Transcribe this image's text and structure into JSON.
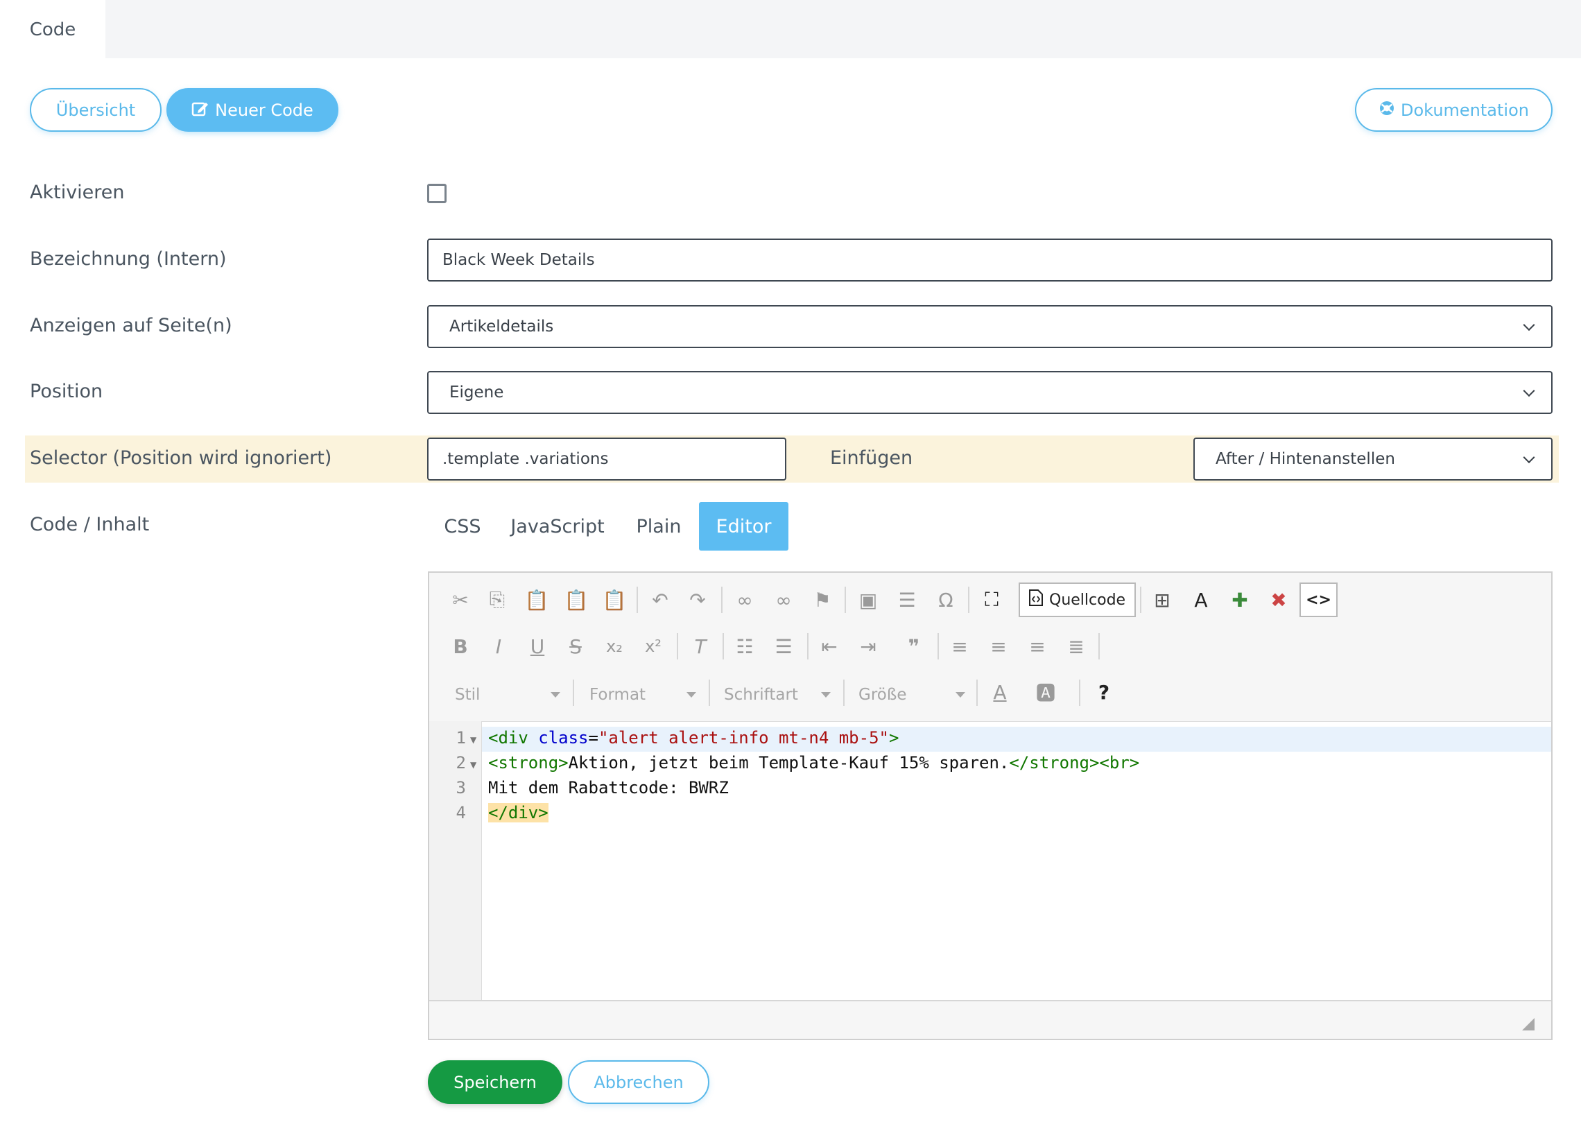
{
  "tabs": [
    {
      "label": "Code"
    }
  ],
  "header": {
    "overview_label": "Übersicht",
    "new_code_label": "Neuer Code",
    "docs_label": "Dokumentation"
  },
  "form": {
    "activate_label": "Aktivieren",
    "activate_checked": false,
    "name_label": "Bezeichnung (Intern)",
    "name_value": "Black Week Details",
    "pages_label": "Anzeigen auf Seite(n)",
    "pages_value": "Artikeldetails",
    "position_label": "Position",
    "position_value": "Eigene",
    "selector_label": "Selector (Position wird ignoriert)",
    "selector_value": ".template .variations",
    "insert_label": "Einfügen",
    "insert_value": "After / Hintenanstellen",
    "code_label": "Code / Inhalt"
  },
  "code_tabs": [
    {
      "label": "CSS",
      "active": false
    },
    {
      "label": "JavaScript",
      "active": false
    },
    {
      "label": "Plain",
      "active": false
    },
    {
      "label": "Editor",
      "active": true
    }
  ],
  "toolbar": {
    "source_label": "Quellcode",
    "style_label": "Stil",
    "format_label": "Format",
    "font_label": "Schriftart",
    "size_label": "Größe",
    "help_label": "?"
  },
  "code": {
    "line_numbers": [
      "1",
      "2",
      "3",
      "4"
    ],
    "lines": [
      "<div class=\"alert alert-info mt-n4 mb-5\">",
      "<strong>Aktion, jetzt beim Template-Kauf 15% sparen.</strong><br>",
      "Mit dem Rabattcode: BWRZ",
      "</div>"
    ]
  },
  "actions": {
    "save_label": "Speichern",
    "cancel_label": "Abbrechen"
  },
  "colors": {
    "accent": "#5cbcf2",
    "save_green": "#159a43",
    "highlight_row": "#fbf3dc"
  }
}
